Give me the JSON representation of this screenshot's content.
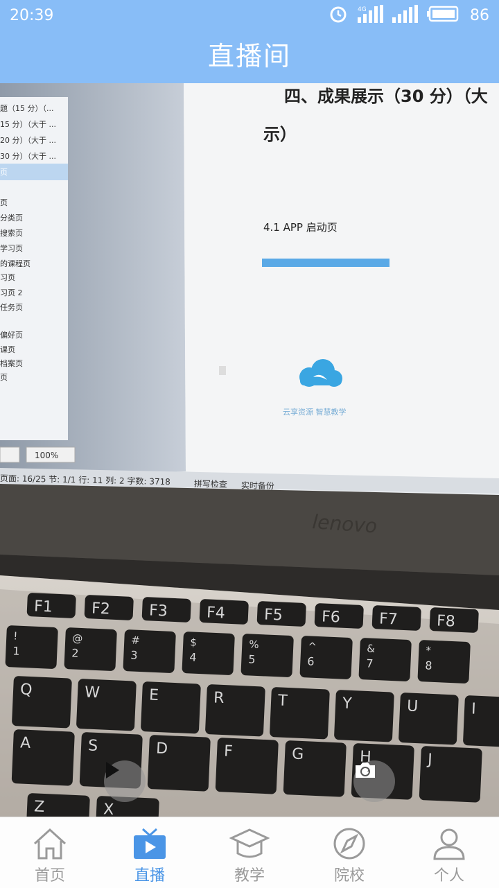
{
  "status_bar": {
    "time": "20:39",
    "network": "4G",
    "battery": "86"
  },
  "header": {
    "title": "直播间"
  },
  "screen": {
    "heading_line1": "四、成果展示（30 分）（大",
    "heading_line2": "示）",
    "section": "4.1 APP 启动页",
    "splash_caption": "云享资源 智慧教学",
    "nav_items": [
      "题（15 分）（...",
      "15 分）（大于 ...",
      "20 分）（大于 ...",
      "30 分）（大于 ...",
      "页",
      "",
      "页",
      "分类页",
      "搜索页",
      "学习页",
      "的课程页",
      "习页",
      "习页 2",
      "任务页",
      "",
      "偏好页",
      "课页",
      "档案页",
      "页"
    ],
    "zoom": "100%",
    "status_line": "页面: 16/25  节: 1/1  行: 11  列: 2  字数: 3718",
    "spellcheck": "拼写检查",
    "backup": "实时备份"
  },
  "laptop_brand": "lenovo",
  "keys": {
    "f_row": [
      "F1",
      "F2",
      "F3",
      "F4",
      "F5",
      "F6",
      "F7",
      "F8"
    ],
    "num_top": [
      "!",
      "@",
      "#",
      "$",
      "%",
      "^",
      "&",
      "*"
    ],
    "num_bottom": [
      "1",
      "2",
      "3",
      "4",
      "5",
      "6",
      "7",
      "8"
    ],
    "row_q": [
      "Q",
      "W",
      "E",
      "R",
      "T",
      "Y",
      "U",
      "I"
    ],
    "row_a": [
      "A",
      "S",
      "D",
      "F",
      "G",
      "H",
      "J"
    ],
    "row_z": [
      "Z",
      "X"
    ]
  },
  "tabs": [
    {
      "label": "首页",
      "icon": "home-icon",
      "active": false
    },
    {
      "label": "直播",
      "icon": "tv-icon",
      "active": true
    },
    {
      "label": "教学",
      "icon": "graduation-cap-icon",
      "active": false
    },
    {
      "label": "院校",
      "icon": "compass-icon",
      "active": false
    },
    {
      "label": "个人",
      "icon": "person-icon",
      "active": false
    }
  ],
  "colors": {
    "header_bg": "#88bdf7",
    "accent": "#4a95e6",
    "tab_inactive": "#9a9a9a"
  }
}
